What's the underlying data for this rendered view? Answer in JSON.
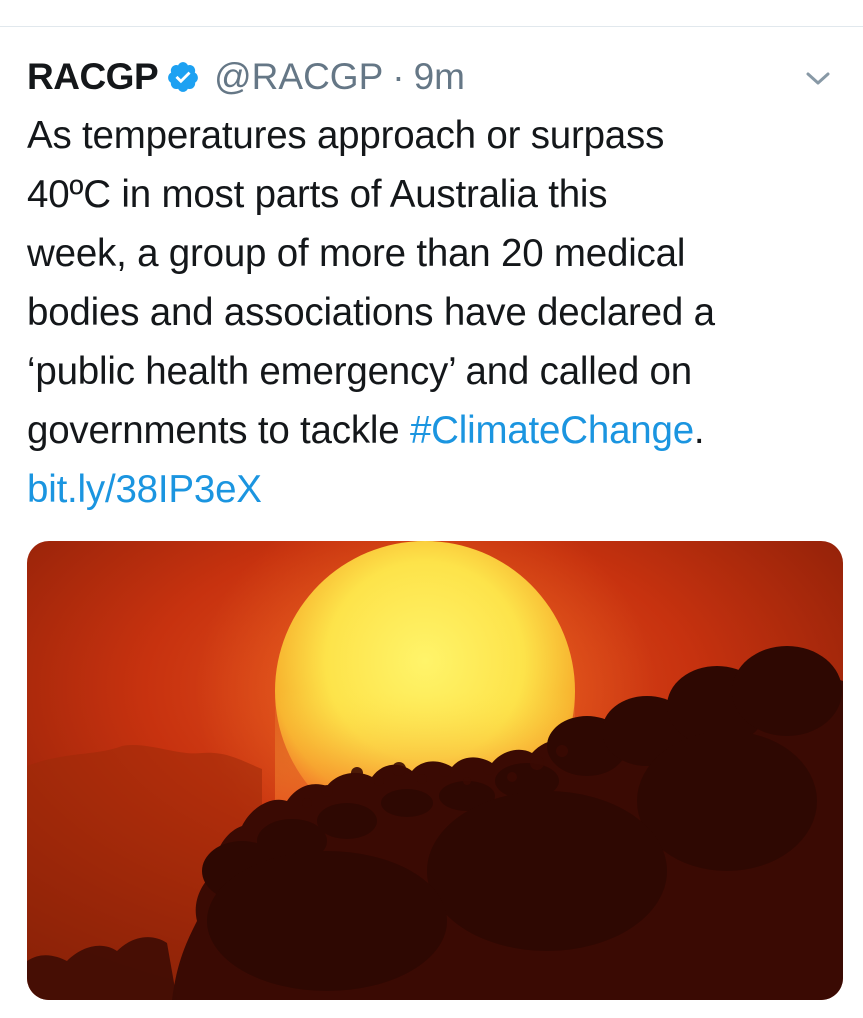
{
  "tweet": {
    "display_name": "RACGP",
    "handle": "@RACGP",
    "separator": "·",
    "time": "9m",
    "text_lines": [
      "As temperatures approach or surpass",
      "40ºC in most parts of Australia this",
      "week, a group of more than 20 medical",
      "bodies and associations have declared a",
      "‘public health emergency’ and called on"
    ],
    "last_line_prefix": "governments to tackle ",
    "hashtag": "#ClimateChange",
    "last_line_suffix": ".",
    "link": "bit.ly/38IP3eX",
    "icons": {
      "verified": "verified-badge-icon",
      "caret": "chevron-down-icon"
    },
    "colors": {
      "link": "#1b95e0",
      "verified": "#1da1f2",
      "text": "#14171a",
      "muted": "#657786"
    }
  }
}
